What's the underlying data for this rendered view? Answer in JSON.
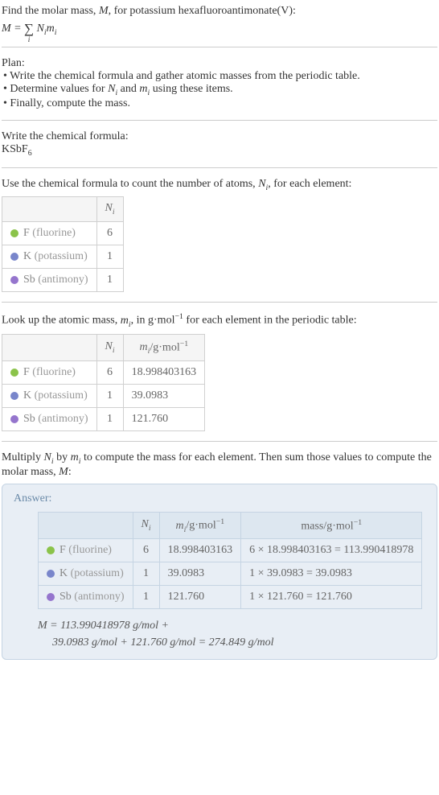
{
  "intro": {
    "line1": "Find the molar mass, M, for potassium hexafluoroantimonate(V):"
  },
  "plan": {
    "title": "Plan:",
    "items": [
      "Write the chemical formula and gather atomic masses from the periodic table.",
      "Determine values for N_i and m_i using these items.",
      "Finally, compute the mass."
    ]
  },
  "formula_section": {
    "title": "Write the chemical formula:",
    "formula": "KSbF",
    "formula_sub": "6"
  },
  "count_section": {
    "title_a": "Use the chemical formula to count the number of atoms, ",
    "title_b": "N",
    "title_c": ", for each element:"
  },
  "mass_section": {
    "title_a": "Look up the atomic mass, ",
    "title_b": "m",
    "title_c": ", in g·mol",
    "title_d": " for each element in the periodic table:"
  },
  "multiply_section": {
    "text": "Multiply N_i by m_i to compute the mass for each element. Then sum those values to compute the molar mass, M:"
  },
  "headers": {
    "Ni": "N",
    "mi": "m",
    "mi_unit": "/g·mol",
    "mass": "mass/g·mol"
  },
  "chart_data": {
    "type": "table",
    "elements": [
      {
        "symbol": "F",
        "name": "(fluorine)",
        "dot": "dot-f",
        "Ni": 6,
        "mi": "18.998403163",
        "mass_calc": "6 × 18.998403163 = 113.990418978"
      },
      {
        "symbol": "K",
        "name": "(potassium)",
        "dot": "dot-k",
        "Ni": 1,
        "mi": "39.0983",
        "mass_calc": "1 × 39.0983 = 39.0983"
      },
      {
        "symbol": "Sb",
        "name": "(antimony)",
        "dot": "dot-sb",
        "Ni": 1,
        "mi": "121.760",
        "mass_calc": "1 × 121.760 = 121.760"
      }
    ]
  },
  "answer": {
    "label": "Answer:",
    "result_line1": "M = 113.990418978 g/mol +",
    "result_line2": "39.0983 g/mol + 121.760 g/mol = 274.849 g/mol"
  }
}
